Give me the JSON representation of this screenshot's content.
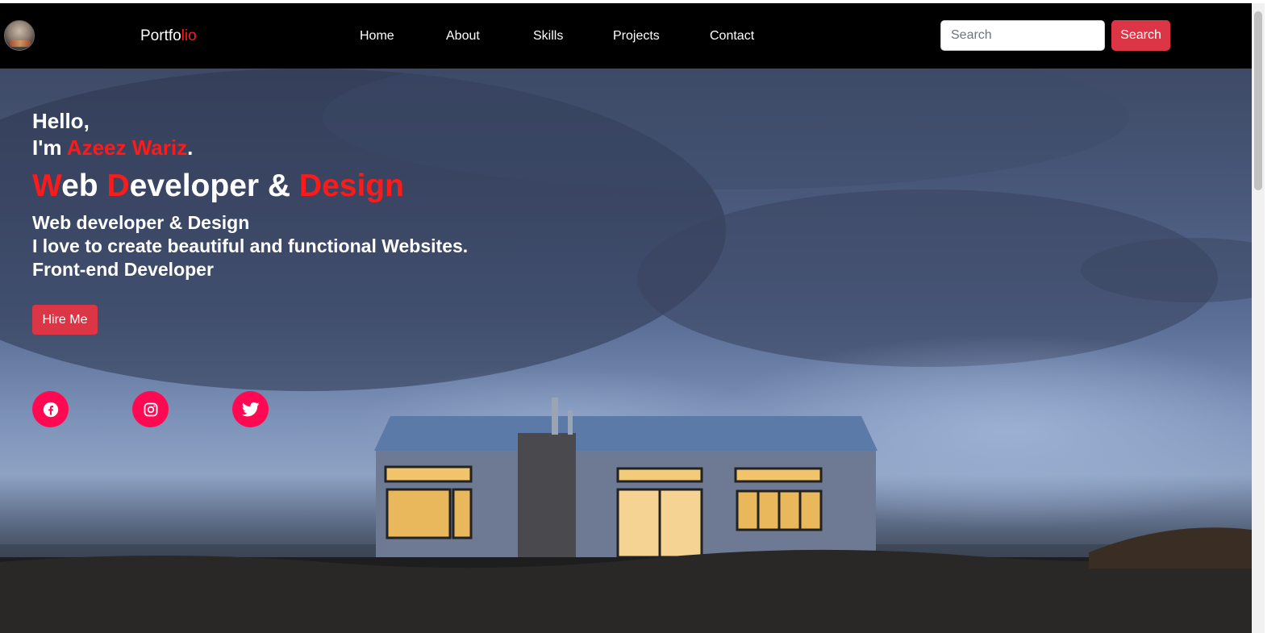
{
  "navbar": {
    "brand_main": "Portfo",
    "brand_accent": "lio",
    "links": [
      "Home",
      "About",
      "Skills",
      "Projects",
      "Contact"
    ],
    "search_placeholder": "Search",
    "search_button": "Search"
  },
  "hero": {
    "hello": "Hello,",
    "im_prefix": "I'm ",
    "name": "Azeez Wariz",
    "period": ".",
    "title_parts": [
      "W",
      "eb ",
      "D",
      "eveloper & ",
      "Design"
    ],
    "lines": [
      "Web developer & Design",
      "I love to create beautiful and functional Websites.",
      "Front-end Developer"
    ],
    "hire_button": "Hire Me"
  },
  "social": [
    "facebook-icon",
    "instagram-icon",
    "twitter-icon"
  ],
  "colors": {
    "accent": "#ff1a1a",
    "button": "#dc3545",
    "social": "#ff0a52",
    "navbar": "#000000"
  }
}
